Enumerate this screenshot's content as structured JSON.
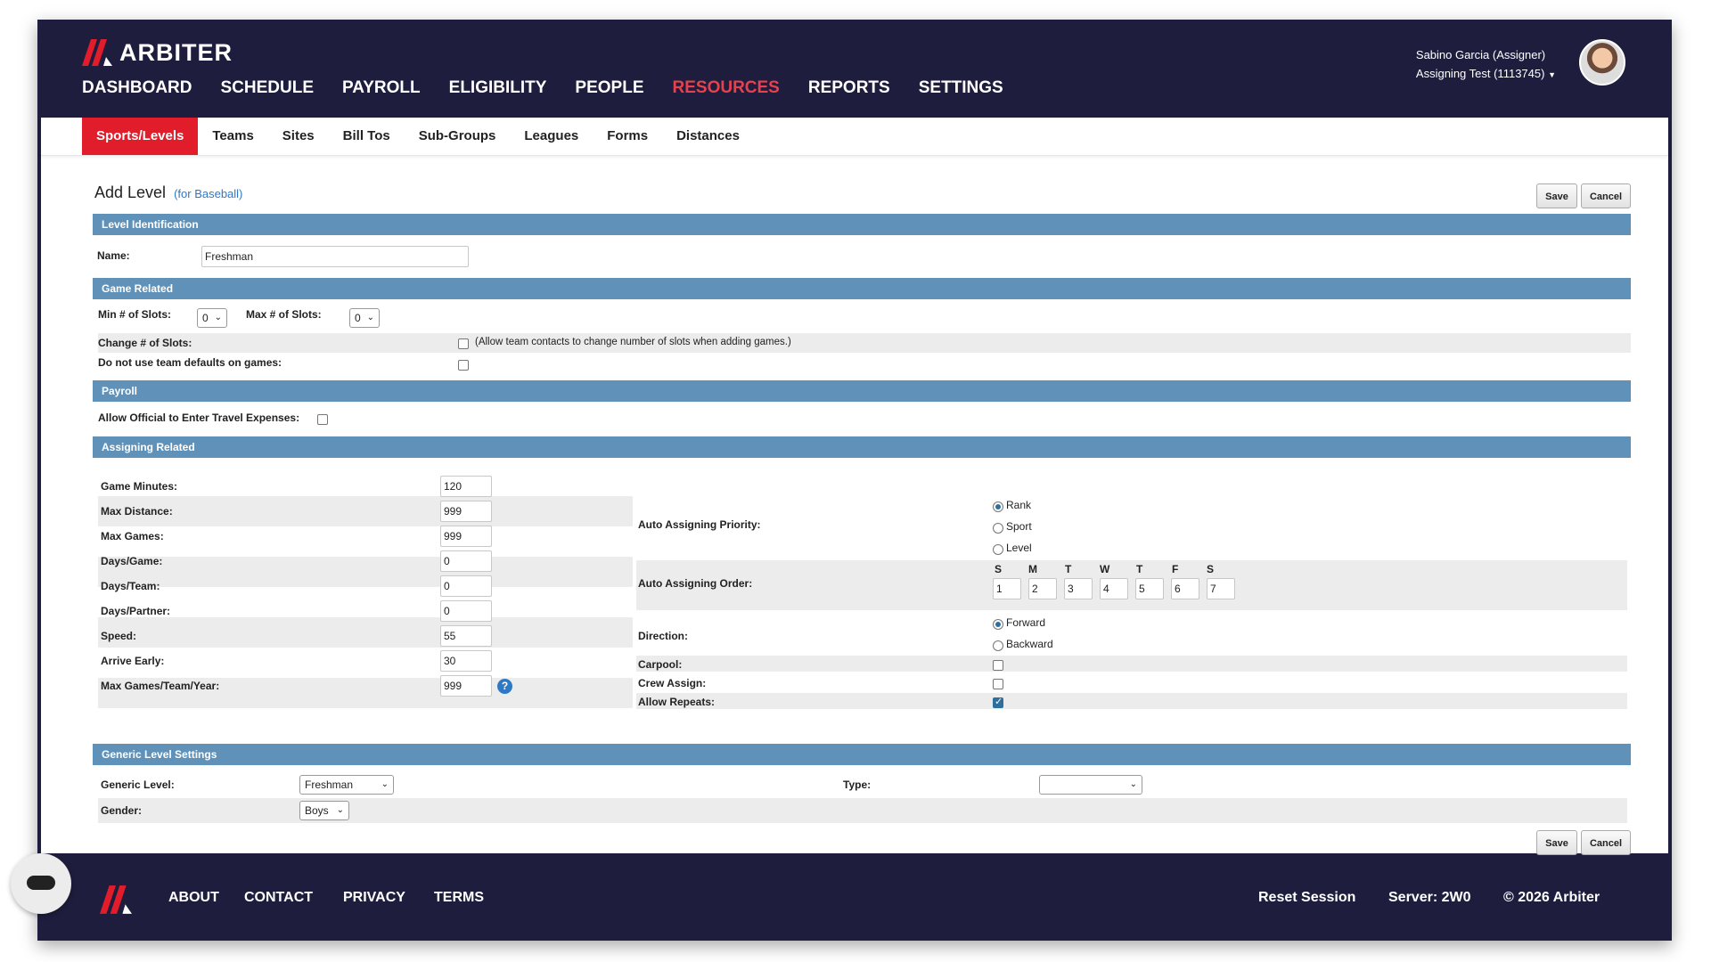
{
  "app": {
    "brand": "ARBITER",
    "nav": [
      "DASHBOARD",
      "SCHEDULE",
      "PAYROLL",
      "ELIGIBILITY",
      "PEOPLE",
      "RESOURCES",
      "REPORTS",
      "SETTINGS"
    ],
    "active_nav": "RESOURCES",
    "user_name": "Sabino Garcia (Assigner)",
    "user_account": "Assigning Test (1113745)",
    "brand_color": "#e11c2b",
    "header_color": "#1e1d3d"
  },
  "subnav": {
    "tabs": [
      "Sports/Levels",
      "Teams",
      "Sites",
      "Bill Tos",
      "Sub-Groups",
      "Leagues",
      "Forms",
      "Distances"
    ],
    "active": "Sports/Levels"
  },
  "page": {
    "title": "Add Level",
    "subtitle": "(for Baseball)",
    "save_label": "Save",
    "cancel_label": "Cancel"
  },
  "sections": {
    "level_identification": "Level Identification",
    "game_related": "Game Related",
    "payroll": "Payroll",
    "assigning_related": "Assigning Related",
    "generic_level_settings": "Generic Level Settings"
  },
  "level": {
    "name_label": "Name:",
    "name_value": "Freshman"
  },
  "game": {
    "min_slots_label": "Min # of Slots:",
    "min_slots_value": "0",
    "max_slots_label": "Max # of Slots:",
    "max_slots_value": "0",
    "change_slots_label": "Change # of Slots:",
    "change_slots_note": "(Allow team contacts to change number of slots when adding games.)",
    "change_slots_checked": false,
    "no_team_defaults_label": "Do not use team defaults on games:",
    "no_team_defaults_checked": false
  },
  "payroll": {
    "travel_label": "Allow Official to Enter Travel Expenses:",
    "travel_checked": false
  },
  "assigning": {
    "fields": [
      {
        "label": "Game Minutes:",
        "value": "120"
      },
      {
        "label": "Max Distance:",
        "value": "999"
      },
      {
        "label": "Max Games:",
        "value": "999"
      },
      {
        "label": "Days/Game:",
        "value": "0"
      },
      {
        "label": "Days/Team:",
        "value": "0"
      },
      {
        "label": "Days/Partner:",
        "value": "0"
      },
      {
        "label": "Speed:",
        "value": "55"
      },
      {
        "label": "Arrive Early:",
        "value": "30"
      },
      {
        "label": "Max Games/Team/Year:",
        "value": "999"
      }
    ],
    "help_icon": "question-circle-icon",
    "priority_label": "Auto Assigning Priority:",
    "priority_options": [
      "Rank",
      "Sport",
      "Level"
    ],
    "priority_selected": "Rank",
    "order_label": "Auto Assigning Order:",
    "order_days": [
      "S",
      "M",
      "T",
      "W",
      "T",
      "F",
      "S"
    ],
    "order_values": [
      "1",
      "2",
      "3",
      "4",
      "5",
      "6",
      "7"
    ],
    "direction_label": "Direction:",
    "direction_options": [
      "Forward",
      "Backward"
    ],
    "direction_selected": "Forward",
    "carpool_label": "Carpool:",
    "carpool_checked": false,
    "crew_label": "Crew Assign:",
    "crew_checked": false,
    "repeats_label": "Allow Repeats:",
    "repeats_checked": true
  },
  "generic": {
    "level_label": "Generic Level:",
    "level_value": "Freshman",
    "type_label": "Type:",
    "type_value": "",
    "gender_label": "Gender:",
    "gender_value": "Boys"
  },
  "footer": {
    "links": [
      "ABOUT",
      "CONTACT",
      "PRIVACY",
      "TERMS"
    ],
    "reset": "Reset Session",
    "server": "Server: 2W0",
    "copyright": "© 2026 Arbiter"
  }
}
